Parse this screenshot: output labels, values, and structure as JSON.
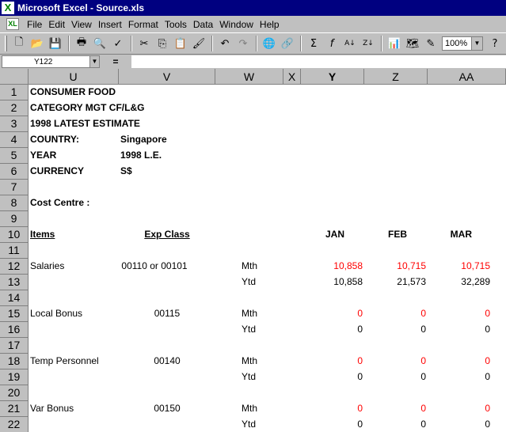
{
  "window": {
    "title": "Microsoft Excel - Source.xls",
    "app_icon_glyph": "X"
  },
  "menu": [
    "File",
    "Edit",
    "View",
    "Insert",
    "Format",
    "Tools",
    "Data",
    "Window",
    "Help"
  ],
  "toolbar": {
    "zoom": "100%"
  },
  "formula_bar": {
    "name_box": "Y122",
    "equals": "="
  },
  "columns": [
    "U",
    "V",
    "W",
    "X",
    "Y",
    "Z",
    "AA"
  ],
  "rows": [
    "1",
    "2",
    "3",
    "4",
    "5",
    "6",
    "7",
    "8",
    "9",
    "10",
    "11",
    "12",
    "13",
    "14",
    "15",
    "16",
    "17",
    "18",
    "19",
    "20",
    "21",
    "22"
  ],
  "sheet": {
    "r1": {
      "u": "CONSUMER FOOD"
    },
    "r2": {
      "u": "CATEGORY MGT CF/L&G"
    },
    "r3": {
      "u": "1998 LATEST ESTIMATE"
    },
    "r4": {
      "u": "COUNTRY:",
      "v": "Singapore"
    },
    "r5": {
      "u": "YEAR",
      "v": "1998 L.E."
    },
    "r6": {
      "u": "CURRENCY",
      "v": "S$"
    },
    "r8": {
      "u": "Cost Centre :"
    },
    "r10": {
      "u": "Items",
      "v": "Exp Class",
      "y": "JAN",
      "z": "FEB",
      "aa": "MAR"
    },
    "r12": {
      "u": "Salaries",
      "v": "00110 or 00101",
      "w": "Mth",
      "y": "10,858",
      "z": "10,715",
      "aa": "10,715"
    },
    "r13": {
      "w": "Ytd",
      "y": "10,858",
      "z": "21,573",
      "aa": "32,289"
    },
    "r15": {
      "u": "Local Bonus",
      "v": "00115",
      "w": "Mth",
      "y": "0",
      "z": "0",
      "aa": "0"
    },
    "r16": {
      "w": "Ytd",
      "y": "0",
      "z": "0",
      "aa": "0"
    },
    "r18": {
      "u": "Temp Personnel",
      "v": "00140",
      "w": "Mth",
      "y": "0",
      "z": "0",
      "aa": "0"
    },
    "r19": {
      "w": "Ytd",
      "y": "0",
      "z": "0",
      "aa": "0"
    },
    "r21": {
      "u": "Var Bonus",
      "v": "00150",
      "w": "Mth",
      "y": "0",
      "z": "0",
      "aa": "0"
    },
    "r22": {
      "w": "Ytd",
      "y": "0",
      "z": "0",
      "aa": "0"
    }
  },
  "colors": {
    "title_bar": "#000080",
    "chrome": "#c0c0c0",
    "monthly_value": "#ff0000"
  }
}
